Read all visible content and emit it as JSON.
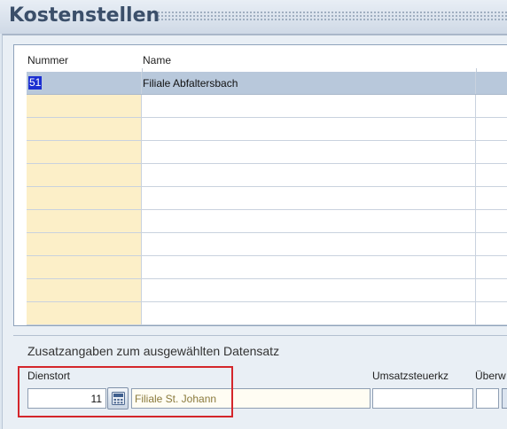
{
  "window": {
    "title": "Kostenstellen"
  },
  "grid": {
    "columns": [
      "Nummer",
      "Name"
    ],
    "rows": [
      {
        "nummer": "51",
        "name": "Filiale Abfaltersbach",
        "selected": true
      }
    ],
    "empty_row_count": 10
  },
  "details": {
    "section_title": "Zusatzangaben zum ausgewählten Datensatz",
    "dienstort": {
      "label": "Dienstort",
      "value": "11",
      "name": "Filiale St. Johann"
    },
    "umsatzsteuerkz": {
      "label": "Umsatzsteuerkz",
      "value": ""
    },
    "uberw": {
      "label": "Überw",
      "value": ""
    }
  },
  "colors": {
    "highlight_red": "#d4262b",
    "selected_row": "#b8c8db",
    "number_column_bg": "#fcefc8",
    "title_text": "#3b4f6a"
  },
  "icons": {
    "dienstort_lookup": "calculator-icon"
  }
}
